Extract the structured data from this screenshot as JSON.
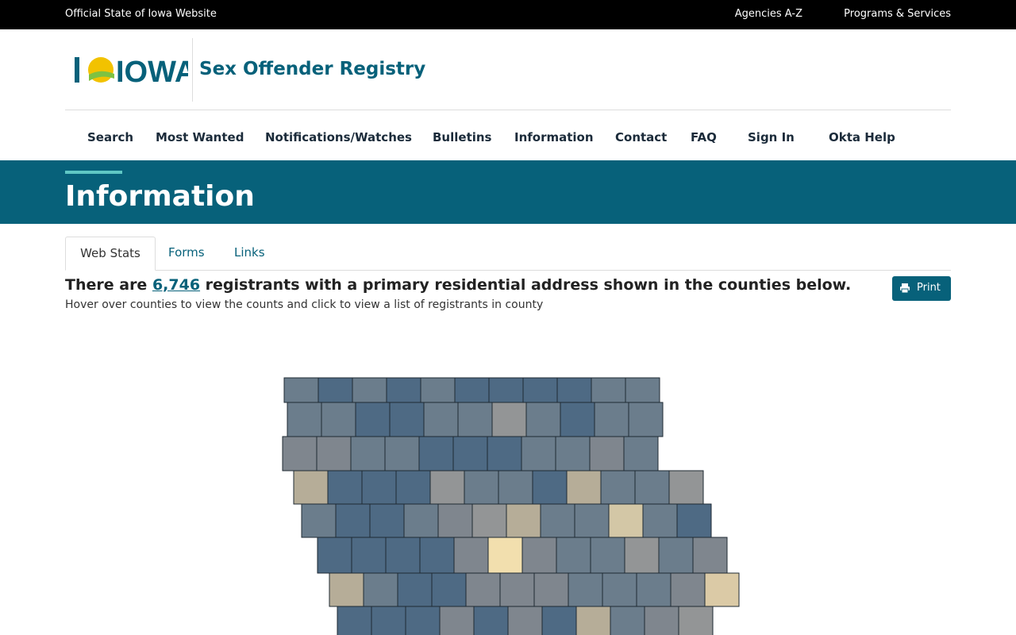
{
  "topbar": {
    "official": "Official State of Iowa Website",
    "links": [
      "Agencies A-Z",
      "Programs & Services"
    ]
  },
  "header": {
    "logo_text": "IOWA",
    "title": "Sex Offender Registry"
  },
  "nav": {
    "items": [
      "Search",
      "Most Wanted",
      "Notifications/Watches",
      "Bulletins",
      "Information",
      "Contact",
      "FAQ",
      "Sign In",
      "Okta Help"
    ]
  },
  "page": {
    "title": "Information"
  },
  "tabs": [
    "Web Stats",
    "Forms",
    "Links"
  ],
  "stats": {
    "prefix": "There are ",
    "count": "6,746",
    "suffix": " registrants with a primary residential address shown in the counties below.",
    "hint": "Hover over counties to view the counts and click to view a list of registrants in county"
  },
  "print_label": "Print",
  "colors": {
    "brand": "#07617a",
    "accent": "#5fc7c4",
    "logo_sun": "#f2c200",
    "logo_green": "#7dc242"
  },
  "map": {
    "palette": {
      "A": "#6b7d8c",
      "B": "#4e6a84",
      "C": "#7f868e",
      "D": "#939596",
      "E": "#b6ad98",
      "F": "#d3c7a6",
      "G": "#f2dfae",
      "H": "#dbcaa6"
    },
    "rows": [
      [
        "A",
        "B",
        "A",
        "B",
        "A",
        "B",
        "B",
        "B",
        "B",
        "A",
        "A"
      ],
      [
        "A",
        "A",
        "B",
        "B",
        "A",
        "A",
        "D",
        "A",
        "B",
        "A",
        "A"
      ],
      [
        "C",
        "C",
        "A",
        "A",
        "B",
        "B",
        "B",
        "A",
        "A",
        "C",
        "A"
      ],
      [
        "E",
        "B",
        "B",
        "B",
        "D",
        "A",
        "A",
        "B",
        "E",
        "A",
        "A",
        "D"
      ],
      [
        "A",
        "B",
        "B",
        "A",
        "C",
        "D",
        "E",
        "A",
        "A",
        "F",
        "A",
        "B"
      ],
      [
        "B",
        "B",
        "B",
        "B",
        "C",
        "G",
        "C",
        "A",
        "A",
        "D",
        "A",
        "C"
      ],
      [
        "E",
        "A",
        "B",
        "B",
        "C",
        "C",
        "C",
        "A",
        "A",
        "A",
        "C",
        "H"
      ],
      [
        "B",
        "B",
        "B",
        "C",
        "B",
        "C",
        "B",
        "E",
        "A",
        "C",
        "D"
      ]
    ]
  }
}
